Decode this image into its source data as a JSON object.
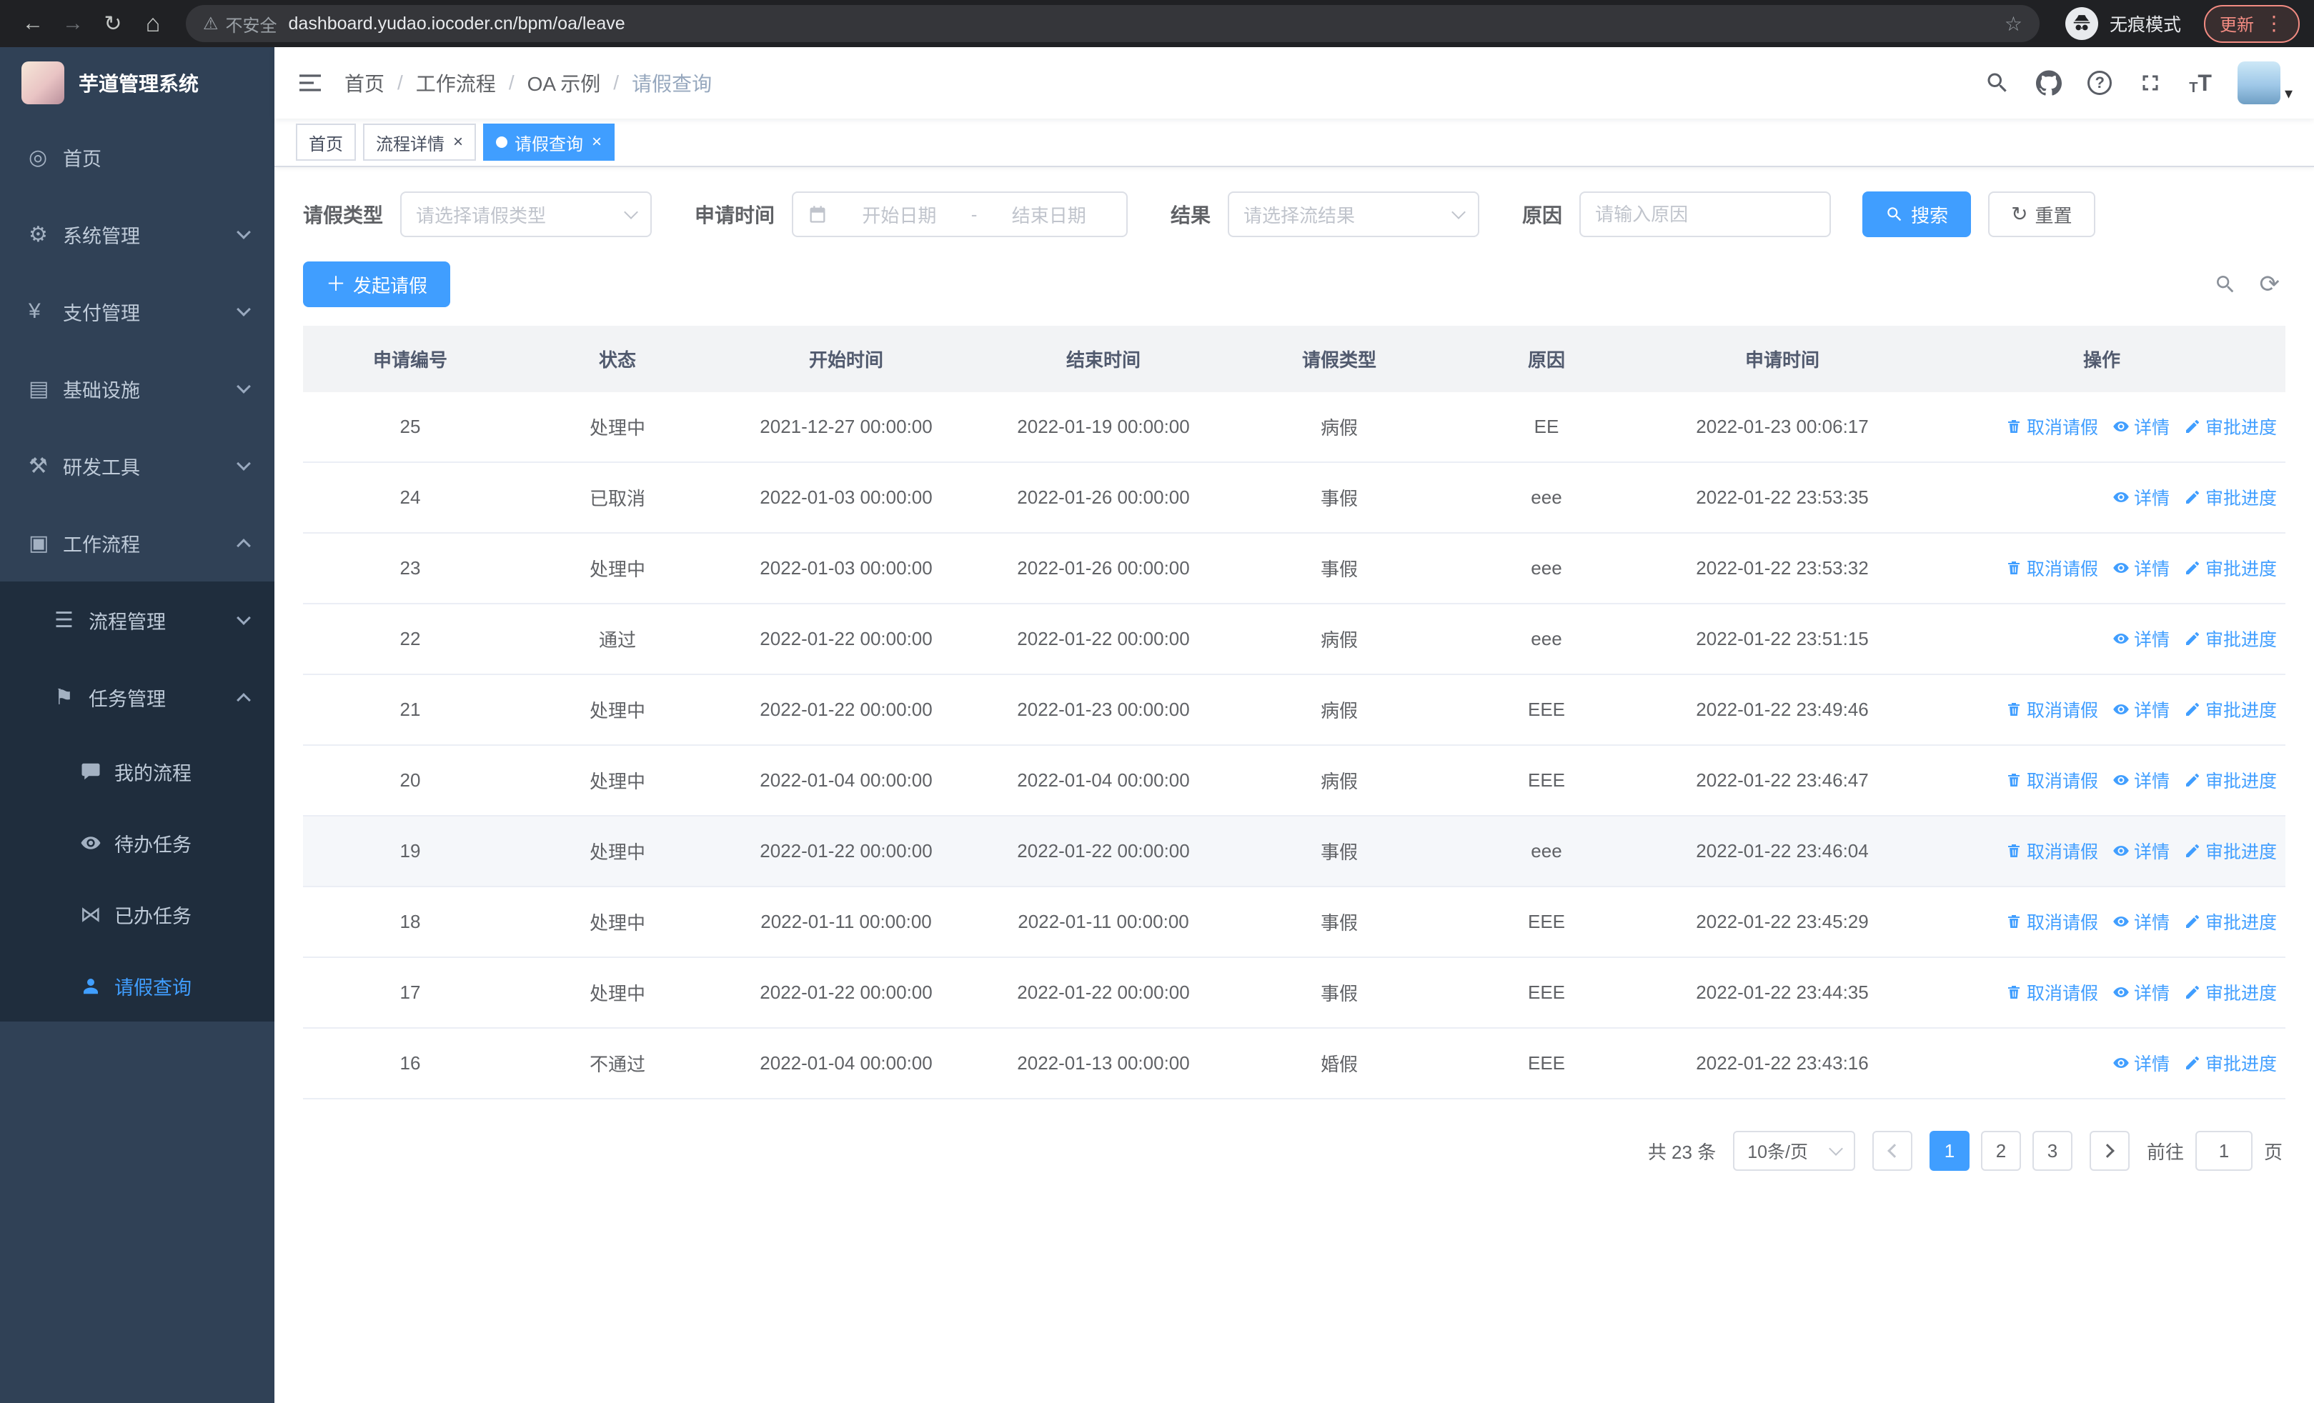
{
  "theme": {
    "primary": "#409eff",
    "sidebar_bg": "#304156",
    "sidebar_sub_bg": "#1f2d3d",
    "table_header_bg": "#f2f3f5"
  },
  "browser": {
    "security_label": "不安全",
    "url": "dashboard.yudao.iocoder.cn/bpm/oa/leave",
    "incognito_label": "无痕模式",
    "update_label": "更新"
  },
  "sidebar": {
    "logo_title": "芋道管理系统",
    "menu": [
      {
        "key": "home",
        "label": "首页",
        "icon": "dashboard-icon",
        "expandable": false
      },
      {
        "key": "system",
        "label": "系统管理",
        "icon": "gear-icon",
        "expandable": true,
        "expanded": false
      },
      {
        "key": "payment",
        "label": "支付管理",
        "icon": "yen-icon",
        "expandable": true,
        "expanded": false
      },
      {
        "key": "infrastructure",
        "label": "基础设施",
        "icon": "infrastructure-icon",
        "expandable": true,
        "expanded": false
      },
      {
        "key": "devtools",
        "label": "研发工具",
        "icon": "tools-icon",
        "expandable": true,
        "expanded": false
      },
      {
        "key": "workflow",
        "label": "工作流程",
        "icon": "briefcase-icon",
        "expandable": true,
        "expanded": true,
        "children": [
          {
            "key": "process-management",
            "label": "流程管理",
            "icon": "list-icon",
            "expandable": true,
            "expanded": false
          },
          {
            "key": "task-management",
            "label": "任务管理",
            "icon": "flag-icon",
            "expandable": true,
            "expanded": true,
            "children": [
              {
                "key": "my-process",
                "label": "我的流程",
                "icon": "message-icon"
              },
              {
                "key": "todo-tasks",
                "label": "待办任务",
                "icon": "eye-icon"
              },
              {
                "key": "done-tasks",
                "label": "已办任务",
                "icon": "check-icon"
              },
              {
                "key": "leave-query",
                "label": "请假查询",
                "icon": "user-icon",
                "active": true
              }
            ]
          }
        ]
      }
    ]
  },
  "header": {
    "breadcrumb": {
      "separator": "/",
      "items": [
        "首页",
        "工作流程",
        "OA 示例",
        "请假查询"
      ]
    },
    "tabs": [
      {
        "key": "home",
        "label": "首页",
        "closable": false,
        "active": false
      },
      {
        "key": "process-detail",
        "label": "流程详情",
        "closable": true,
        "active": false
      },
      {
        "key": "leave-query",
        "label": "请假查询",
        "closable": true,
        "active": true
      }
    ]
  },
  "filters": {
    "leave_type": {
      "label": "请假类型",
      "placeholder": "请选择请假类型"
    },
    "apply_time": {
      "label": "申请时间",
      "start_placeholder": "开始日期",
      "separator": "-",
      "end_placeholder": "结束日期"
    },
    "result": {
      "label": "结果",
      "placeholder": "请选择流结果"
    },
    "reason": {
      "label": "原因",
      "placeholder": "请输入原因"
    },
    "search_button": "搜索",
    "reset_button": "重置"
  },
  "toolbar": {
    "create_button": "发起请假"
  },
  "table": {
    "columns": [
      "申请编号",
      "状态",
      "开始时间",
      "结束时间",
      "请假类型",
      "原因",
      "申请时间",
      "操作"
    ],
    "action_labels": {
      "cancel": "取消请假",
      "detail": "详情",
      "progress": "审批进度"
    },
    "rows": [
      {
        "id": "25",
        "status": "处理中",
        "start": "2021-12-27 00:00:00",
        "end": "2022-01-19 00:00:00",
        "type": "病假",
        "reason": "EE",
        "applied": "2022-01-23 00:06:17",
        "actions": [
          "cancel",
          "detail",
          "progress"
        ],
        "highlight": false
      },
      {
        "id": "24",
        "status": "已取消",
        "start": "2022-01-03 00:00:00",
        "end": "2022-01-26 00:00:00",
        "type": "事假",
        "reason": "eee",
        "applied": "2022-01-22 23:53:35",
        "actions": [
          "detail",
          "progress"
        ],
        "highlight": false
      },
      {
        "id": "23",
        "status": "处理中",
        "start": "2022-01-03 00:00:00",
        "end": "2022-01-26 00:00:00",
        "type": "事假",
        "reason": "eee",
        "applied": "2022-01-22 23:53:32",
        "actions": [
          "cancel",
          "detail",
          "progress"
        ],
        "highlight": false
      },
      {
        "id": "22",
        "status": "通过",
        "start": "2022-01-22 00:00:00",
        "end": "2022-01-22 00:00:00",
        "type": "病假",
        "reason": "eee",
        "applied": "2022-01-22 23:51:15",
        "actions": [
          "detail",
          "progress"
        ],
        "highlight": false
      },
      {
        "id": "21",
        "status": "处理中",
        "start": "2022-01-22 00:00:00",
        "end": "2022-01-23 00:00:00",
        "type": "病假",
        "reason": "EEE",
        "applied": "2022-01-22 23:49:46",
        "actions": [
          "cancel",
          "detail",
          "progress"
        ],
        "highlight": false
      },
      {
        "id": "20",
        "status": "处理中",
        "start": "2022-01-04 00:00:00",
        "end": "2022-01-04 00:00:00",
        "type": "病假",
        "reason": "EEE",
        "applied": "2022-01-22 23:46:47",
        "actions": [
          "cancel",
          "detail",
          "progress"
        ],
        "highlight": false
      },
      {
        "id": "19",
        "status": "处理中",
        "start": "2022-01-22 00:00:00",
        "end": "2022-01-22 00:00:00",
        "type": "事假",
        "reason": "eee",
        "applied": "2022-01-22 23:46:04",
        "actions": [
          "cancel",
          "detail",
          "progress"
        ],
        "highlight": true
      },
      {
        "id": "18",
        "status": "处理中",
        "start": "2022-01-11 00:00:00",
        "end": "2022-01-11 00:00:00",
        "type": "事假",
        "reason": "EEE",
        "applied": "2022-01-22 23:45:29",
        "actions": [
          "cancel",
          "detail",
          "progress"
        ],
        "highlight": false
      },
      {
        "id": "17",
        "status": "处理中",
        "start": "2022-01-22 00:00:00",
        "end": "2022-01-22 00:00:00",
        "type": "事假",
        "reason": "EEE",
        "applied": "2022-01-22 23:44:35",
        "actions": [
          "cancel",
          "detail",
          "progress"
        ],
        "highlight": false
      },
      {
        "id": "16",
        "status": "不通过",
        "start": "2022-01-04 00:00:00",
        "end": "2022-01-13 00:00:00",
        "type": "婚假",
        "reason": "EEE",
        "applied": "2022-01-22 23:43:16",
        "actions": [
          "detail",
          "progress"
        ],
        "highlight": false
      }
    ]
  },
  "pagination": {
    "total_text": "共 23 条",
    "page_size": "10条/页",
    "pages": [
      "1",
      "2",
      "3"
    ],
    "current_page": "1",
    "goto_label": "前往",
    "goto_value": "1",
    "goto_suffix": "页"
  }
}
